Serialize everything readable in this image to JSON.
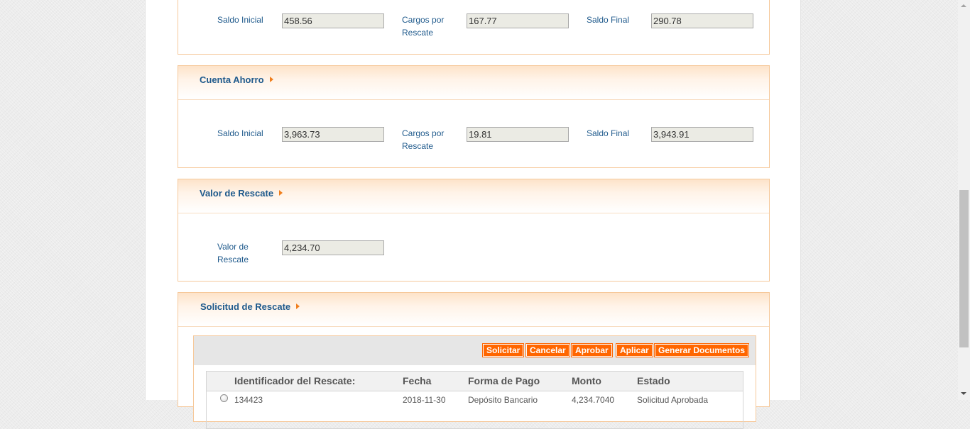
{
  "fondo_panel": {
    "saldo_inicial_label": "Saldo Inicial",
    "saldo_inicial_value": "458.56",
    "cargos_label_1": "Cargos por",
    "cargos_label_2": "Rescate",
    "cargos_value": "167.77",
    "saldo_final_label": "Saldo Final",
    "saldo_final_value": "290.78"
  },
  "cuenta_ahorro": {
    "title": "Cuenta Ahorro",
    "saldo_inicial_label": "Saldo Inicial",
    "saldo_inicial_value": "3,963.73",
    "cargos_label_1": "Cargos por",
    "cargos_label_2": "Rescate",
    "cargos_value": "19.81",
    "saldo_final_label": "Saldo Final",
    "saldo_final_value": "3,943.91"
  },
  "valor_rescate": {
    "title": "Valor de Rescate",
    "label_1": "Valor de",
    "label_2": "Rescate",
    "value": "4,234.70"
  },
  "solicitud_rescate": {
    "title": "Solicitud de Rescate",
    "buttons": {
      "solicitar": "Solicitar",
      "cancelar": "Cancelar",
      "aprobar": "Aprobar",
      "aplicar": "Aplicar",
      "generar": "Generar Documentos"
    },
    "columns": {
      "id": "Identificador del Rescate:",
      "fecha": "Fecha",
      "forma": "Forma de Pago",
      "monto": "Monto",
      "estado": "Estado"
    },
    "rows": [
      {
        "id": "134423",
        "fecha": "2018-11-30",
        "forma": "Depósito Bancario",
        "monto": "4,234.7040",
        "estado": "Solicitud Aprobada"
      }
    ]
  },
  "colors": {
    "accent": "#ff6600",
    "label_text": "#1f5a8c",
    "panel_border": "#f6c99b"
  }
}
